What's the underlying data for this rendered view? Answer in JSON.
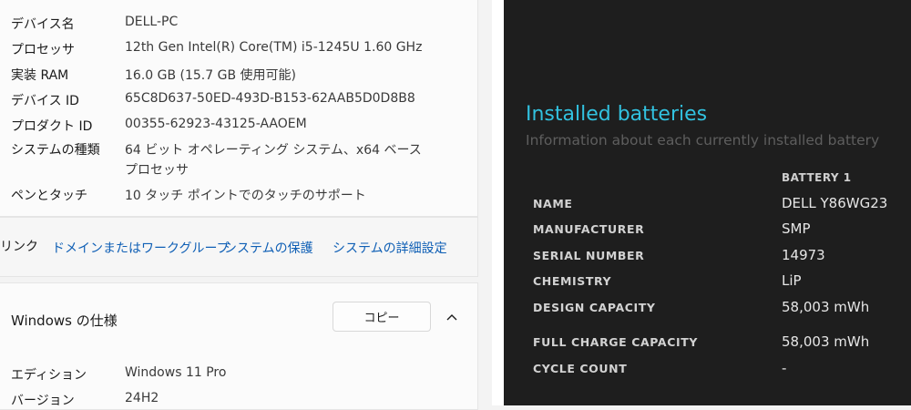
{
  "device_specs": {
    "rows": [
      {
        "label": "デバイス名",
        "value": "DELL-PC"
      },
      {
        "label": "プロセッサ",
        "value": "12th Gen Intel(R) Core(TM) i5-1245U   1.60 GHz"
      },
      {
        "label": "実装 RAM",
        "value": "16.0 GB (15.7 GB 使用可能)"
      },
      {
        "label": "デバイス ID",
        "value": "65C8D637-50ED-493D-B153-62AAB5D0D8B8"
      },
      {
        "label": "プロダクト ID",
        "value": "00355-62923-43125-AAOEM"
      },
      {
        "label": "システムの種類",
        "value": "64 ビット オペレーティング システム、x64 ベース プロセッサ"
      },
      {
        "label": "ペンとタッチ",
        "value": "10 タッチ ポイントでのタッチのサポート"
      }
    ]
  },
  "related_links": {
    "label": "リンク",
    "links": [
      "ドメインまたはワークグループ",
      "システムの保護",
      "システムの詳細設定"
    ]
  },
  "windows_spec": {
    "title": "Windows の仕様",
    "copy_label": "コピー",
    "chevron_icon": "chevron-up-icon",
    "rows": [
      {
        "label": "エディション",
        "value": "Windows 11 Pro"
      },
      {
        "label": "バージョン",
        "value": "24H2"
      }
    ]
  },
  "battery_report": {
    "title": "Installed batteries",
    "subtitle": "Information about each currently installed battery",
    "column": "BATTERY 1",
    "rows": [
      {
        "key": "NAME",
        "value": "DELL Y86WG23"
      },
      {
        "key": "MANUFACTURER",
        "value": "SMP"
      },
      {
        "key": "SERIAL NUMBER",
        "value": "14973"
      },
      {
        "key": "CHEMISTRY",
        "value": "LiP"
      },
      {
        "key": "DESIGN CAPACITY",
        "value": "58,003 mWh"
      },
      {
        "key": "FULL CHARGE CAPACITY",
        "value": "58,003 mWh"
      },
      {
        "key": "CYCLE COUNT",
        "value": "-"
      }
    ],
    "title_color": "#32c2e0"
  }
}
